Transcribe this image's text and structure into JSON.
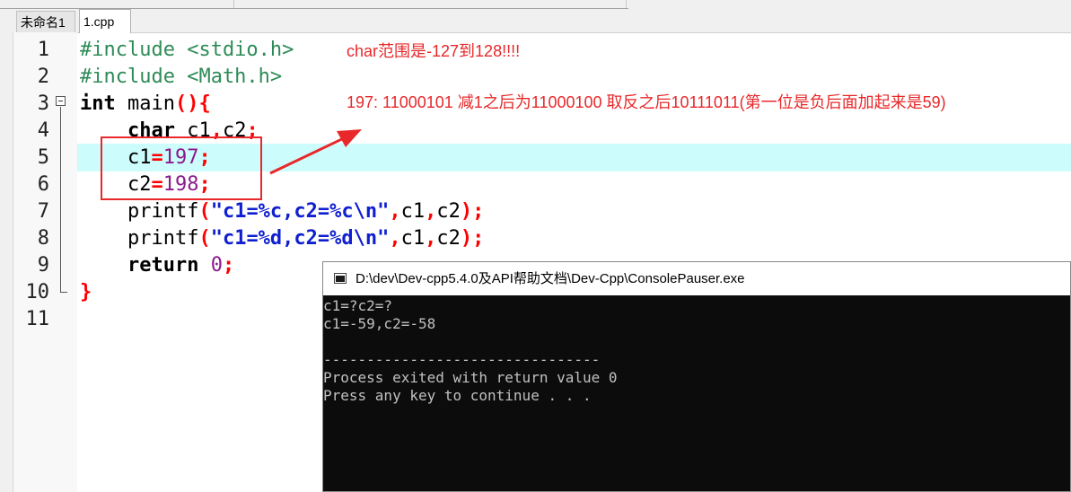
{
  "tabs": [
    {
      "label": "未命名1"
    },
    {
      "label": "1.cpp"
    }
  ],
  "line_numbers": [
    "1",
    "2",
    "3",
    "4",
    "5",
    "6",
    "7",
    "8",
    "9",
    "10",
    "11"
  ],
  "code_lines": [
    [
      "#include <stdio.h>"
    ],
    [
      "#include <Math.h>"
    ],
    [
      "int",
      " main",
      "()",
      "{"
    ],
    [
      "    ",
      "char",
      " c1",
      ",",
      "c2",
      ";"
    ],
    [
      "    c1",
      "=",
      "197",
      ";"
    ],
    [
      "    c2",
      "=",
      "198",
      ";"
    ],
    [
      "    printf",
      "(",
      "\"c1=%c,c2=%c\\n\"",
      ",",
      "c1",
      ",",
      "c2",
      ")",
      ";"
    ],
    [
      "    printf",
      "(",
      "\"c1=%d,c2=%d\\n\"",
      ",",
      "c1",
      ",",
      "c2",
      ")",
      ";"
    ],
    [
      "    ",
      "return",
      " ",
      "0",
      ";"
    ],
    [
      "}"
    ],
    [
      ""
    ]
  ],
  "annotations": {
    "range_note": "char范围是-127到128!!!!",
    "binary_note": "197: 11000101 减1之后为11000100 取反之后10111011(第一位是负后面加起来是59)"
  },
  "console": {
    "title": "D:\\dev\\Dev-cpp5.4.0及API帮助文档\\Dev-Cpp\\ConsolePauser.exe",
    "lines": [
      "c1=?c2=?",
      "c1=-59,c2=-58",
      "",
      "--------------------------------",
      "Process exited with return value 0",
      "Press any key to continue . . ."
    ]
  },
  "colors": {
    "annotation": "#e8282a",
    "current_line_highlight": "#cdfcfd",
    "console_bg": "#0c0c0c",
    "console_text": "#c0c0c0"
  }
}
